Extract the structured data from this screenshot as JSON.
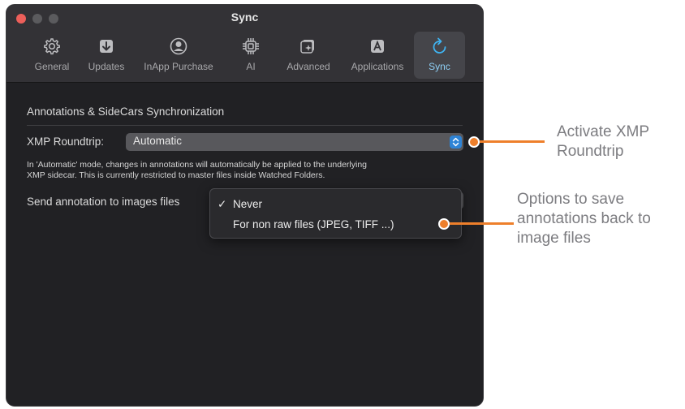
{
  "window": {
    "title": "Sync",
    "traffic_lights": [
      "close",
      "minimize",
      "zoom"
    ]
  },
  "toolbar": {
    "tabs": [
      {
        "label": "General",
        "icon": "gear-icon"
      },
      {
        "label": "Updates",
        "icon": "download-icon"
      },
      {
        "label": "InApp Purchase",
        "icon": "person-circle-icon"
      },
      {
        "label": "AI",
        "icon": "chip-icon"
      },
      {
        "label": "Advanced",
        "icon": "advanced-photo-icon"
      },
      {
        "label": "Applications",
        "icon": "app-a-icon"
      },
      {
        "label": "Sync",
        "icon": "sync-arrow-icon",
        "selected": true
      }
    ]
  },
  "content": {
    "section_title": "Annotations & SideCars Synchronization",
    "xmp_label": "XMP Roundtrip:",
    "xmp_value": "Automatic",
    "help_line1": "In 'Automatic' mode, changes in annotations will automatically be applied to the underlying",
    "help_line2": "XMP sidecar. This is currently restricted to master files inside Watched Folders.",
    "send_label": "Send annotation to images files",
    "send_options": [
      {
        "label": "Never",
        "checked": true,
        "check_mark": "✓"
      },
      {
        "label": "For non raw files (JPEG, TIFF ...)",
        "checked": false
      }
    ]
  },
  "callouts": [
    {
      "line1": "Activate XMP",
      "line2": "Roundtrip"
    },
    {
      "line1": "Options to save",
      "line2": "annotations back to",
      "line3": "image files"
    }
  ],
  "colors": {
    "accent_orange": "#ee7f2b",
    "selection_blue": "#3fb4f2",
    "close_red": "#ec5f5a",
    "window_bg": "#212124"
  }
}
